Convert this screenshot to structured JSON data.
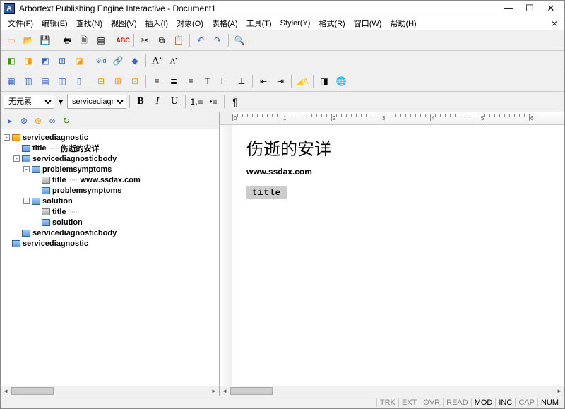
{
  "title": "Arbortext Publishing Engine Interactive - Document1",
  "menus": [
    "文件(F)",
    "编辑(E)",
    "查找(N)",
    "视图(V)",
    "插入(I)",
    "对象(O)",
    "表格(A)",
    "工具(T)",
    "Styler(Y)",
    "格式(R)",
    "窗口(W)",
    "帮助(H)"
  ],
  "elementSelect": {
    "value": "无元素"
  },
  "styleSelect": {
    "value": "servicediagno"
  },
  "tree": [
    {
      "d": 0,
      "tog": "-",
      "ico": "O",
      "label": "servicediagnostic"
    },
    {
      "d": 1,
      "tog": "",
      "ico": "B",
      "label": "title",
      "dots": true,
      "extra": "伤逝的安详"
    },
    {
      "d": 1,
      "tog": "-",
      "ico": "B",
      "label": "servicediagnosticbody"
    },
    {
      "d": 2,
      "tog": "-",
      "ico": "B",
      "label": "problemsymptoms"
    },
    {
      "d": 3,
      "tog": "",
      "ico": "G",
      "label": "title",
      "dots": true,
      "extra": "www.ssdax.com"
    },
    {
      "d": 3,
      "tog": "",
      "ico": "B",
      "label": "problemsymptoms"
    },
    {
      "d": 2,
      "tog": "-",
      "ico": "B",
      "label": "solution"
    },
    {
      "d": 3,
      "tog": "",
      "ico": "G",
      "label": "title",
      "dots": true,
      "extra": ""
    },
    {
      "d": 3,
      "tog": "",
      "ico": "B",
      "label": "solution"
    },
    {
      "d": 1,
      "tog": "",
      "ico": "B",
      "label": "servicediagnosticbody"
    },
    {
      "d": 0,
      "tog": "",
      "ico": "B",
      "label": "servicediagnostic"
    }
  ],
  "doc": {
    "heading": "伤逝的安详",
    "line": "www.ssdax.com",
    "placeholder": "title"
  },
  "status": {
    "items": [
      "TRK",
      "EXT",
      "OVR",
      "READ",
      "MOD",
      "INC",
      "CAP",
      "NUM"
    ],
    "on": [
      "MOD",
      "INC",
      "NUM"
    ]
  }
}
